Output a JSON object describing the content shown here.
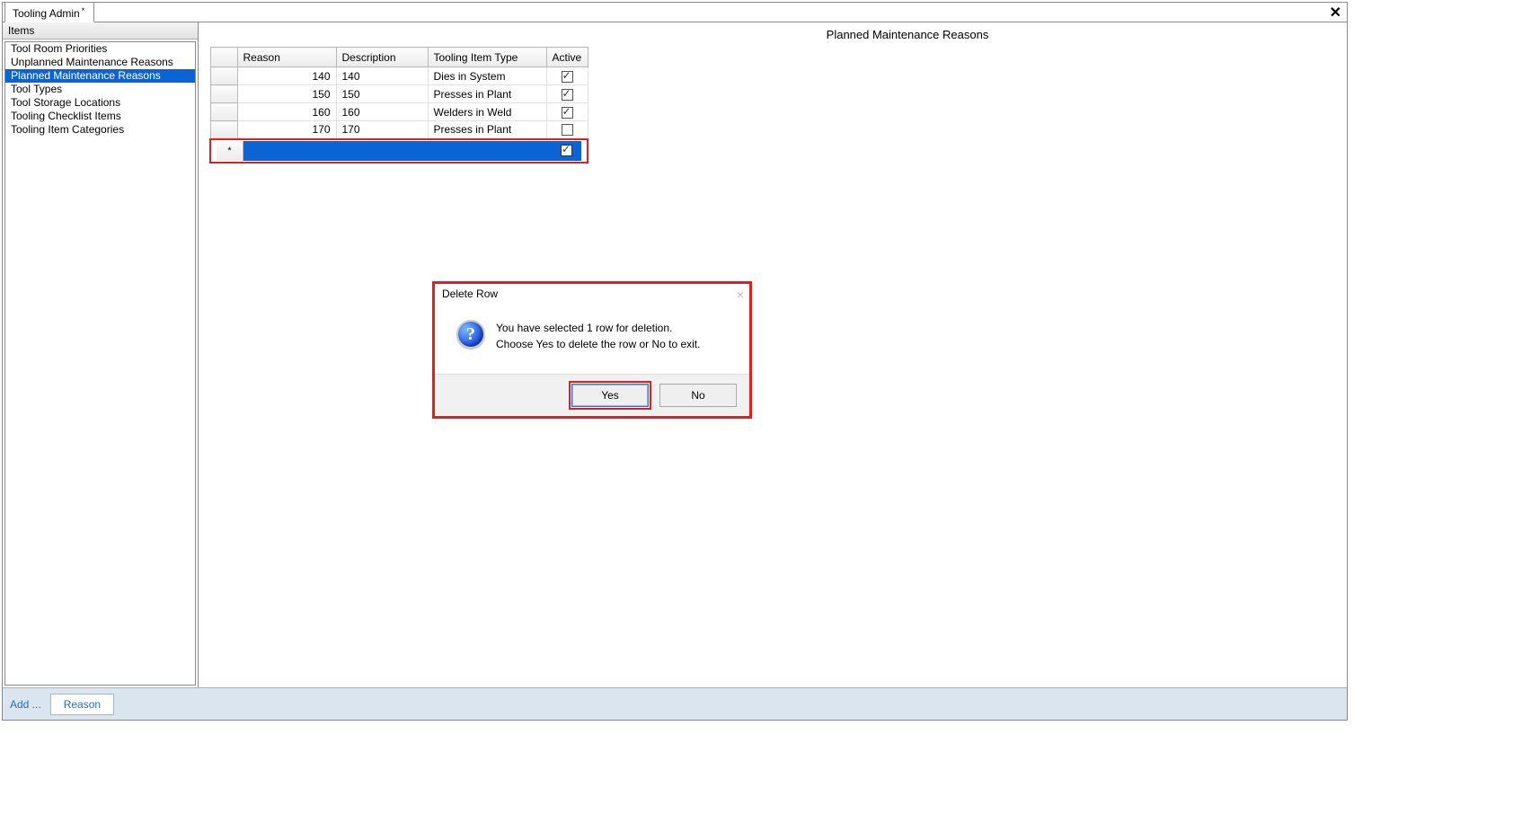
{
  "tab": {
    "title": "Tooling Admin",
    "dirty_marker": "*"
  },
  "close_symbol": "✕",
  "sidebar": {
    "header": "Items",
    "items": [
      {
        "label": "Tool Room Priorities",
        "selected": false
      },
      {
        "label": "Unplanned Maintenance Reasons",
        "selected": false
      },
      {
        "label": "Planned Maintenance Reasons",
        "selected": true
      },
      {
        "label": "Tool Types",
        "selected": false
      },
      {
        "label": "Tool Storage Locations",
        "selected": false
      },
      {
        "label": "Tooling Checklist Items",
        "selected": false
      },
      {
        "label": "Tooling Item Categories",
        "selected": false
      }
    ]
  },
  "page_title": "Planned Maintenance Reasons",
  "grid": {
    "columns": {
      "reason": "Reason",
      "description": "Description",
      "type": "Tooling Item Type",
      "active": "Active"
    },
    "rows": [
      {
        "reason": "140",
        "description": "140",
        "type": "Dies in System",
        "active": true
      },
      {
        "reason": "150",
        "description": "150",
        "type": "Presses in Plant",
        "active": true
      },
      {
        "reason": "160",
        "description": "160",
        "type": "Welders in Weld",
        "active": true
      },
      {
        "reason": "170",
        "description": "170",
        "type": "Presses in Plant",
        "active": false
      }
    ],
    "new_row_marker": "*",
    "new_row_active_checked": true
  },
  "bottom": {
    "add_label": "Add ...",
    "reason_button": "Reason"
  },
  "dialog": {
    "title": "Delete Row",
    "line1": "You have selected 1 row for deletion.",
    "line2": "Choose Yes to delete the row or No to exit.",
    "yes": "Yes",
    "no": "No",
    "question_glyph": "?"
  }
}
